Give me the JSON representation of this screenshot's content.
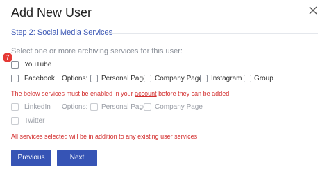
{
  "dialog": {
    "title": "Add New User",
    "step": "Step 2: Social Media Services",
    "instruction": "Select one or more archiving services for this user:",
    "badge": "7"
  },
  "services": {
    "youtube": "YouTube",
    "facebook": "Facebook",
    "options_label": "Options:",
    "facebook_options": [
      "Personal Page",
      "Company Page",
      "Instagram",
      "Group"
    ],
    "linkedin": "LinkedIn",
    "linkedin_options": [
      "Personal Page",
      "Company Page"
    ],
    "twitter": "Twitter"
  },
  "messages": {
    "enable_prefix": "The below services must be enabled in your ",
    "enable_link": "account",
    "enable_suffix": " before they can be added",
    "footer_note": "All services selected will be in addition to any existing user services"
  },
  "buttons": {
    "previous": "Previous",
    "next": "Next"
  },
  "colors": {
    "accent": "#3654b5",
    "error": "#d32f2f",
    "badge": "#e53935"
  }
}
